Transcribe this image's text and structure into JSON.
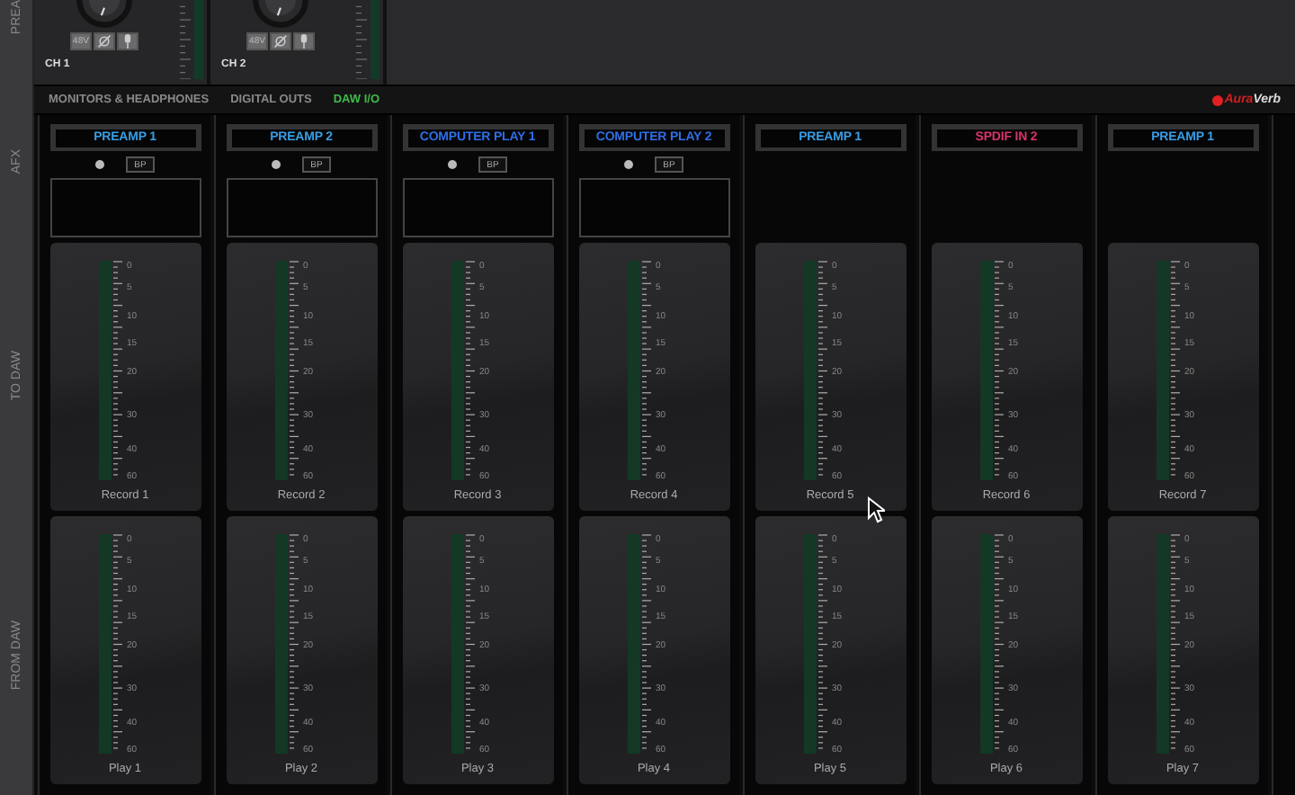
{
  "rail": {
    "preamp": "PREA",
    "afx": "AFX",
    "to_daw": "TO DAW",
    "from_daw": "FROM DAW"
  },
  "strips": [
    {
      "name": "CH 1",
      "phantom": "48V"
    },
    {
      "name": "CH 2",
      "phantom": "48V"
    }
  ],
  "tabs": [
    {
      "label": "MONITORS & HEADPHONES",
      "selected": false
    },
    {
      "label": "DIGITAL OUTS",
      "selected": false
    },
    {
      "label": "DAW I/O",
      "selected": true
    }
  ],
  "logo": {
    "accent": "Aura",
    "rest": "Verb"
  },
  "columns": [
    {
      "source": "PREAMP 1",
      "kind": "preamp",
      "afx": true,
      "bp": "BP",
      "record": "Record 1",
      "record_scale": [
        "0",
        "5",
        "10",
        "15",
        "20",
        "30",
        "40",
        "60"
      ],
      "play": "Play 1",
      "play_scale": [
        "0",
        "5",
        "10",
        "15",
        "20",
        "30",
        "40",
        "60"
      ]
    },
    {
      "source": "PREAMP 2",
      "kind": "preamp",
      "afx": true,
      "bp": "BP",
      "record": "Record 2",
      "record_scale": [
        "0",
        "5",
        "10",
        "15",
        "20",
        "30",
        "40",
        "60"
      ],
      "play": "Play 2",
      "play_scale": [
        "0",
        "5",
        "10",
        "15",
        "20",
        "30",
        "40",
        "60"
      ]
    },
    {
      "source": "COMPUTER PLAY 1",
      "kind": "computer",
      "afx": true,
      "bp": "BP",
      "record": "Record 3",
      "record_scale": [
        "0",
        "5",
        "10",
        "15",
        "20",
        "30",
        "40",
        "60"
      ],
      "play": "Play 3",
      "play_scale": [
        "0",
        "5",
        "10",
        "15",
        "20",
        "30",
        "40",
        "60"
      ]
    },
    {
      "source": "COMPUTER PLAY 2",
      "kind": "computer",
      "afx": true,
      "bp": "BP",
      "record": "Record 4",
      "record_scale": [
        "0",
        "5",
        "10",
        "15",
        "20",
        "30",
        "40",
        "60"
      ],
      "play": "Play 4",
      "play_scale": [
        "0",
        "5",
        "10",
        "15",
        "20",
        "30",
        "40",
        "60"
      ]
    },
    {
      "source": "PREAMP 1",
      "kind": "preamp",
      "afx": false,
      "record": "Record 5",
      "record_scale": [
        "0",
        "5",
        "10",
        "15",
        "20",
        "30",
        "40",
        "60"
      ],
      "play": "Play 5",
      "play_scale": [
        "0",
        "5",
        "10",
        "15",
        "20",
        "30",
        "40",
        "60"
      ]
    },
    {
      "source": "SPDIF IN 2",
      "kind": "spdif",
      "afx": false,
      "record": "Record 6",
      "record_scale": [
        "0",
        "5",
        "10",
        "15",
        "20",
        "30",
        "40",
        "60"
      ],
      "play": "Play 6",
      "play_scale": [
        "0",
        "5",
        "10",
        "15",
        "20",
        "30",
        "40",
        "60"
      ]
    },
    {
      "source": "PREAMP 1",
      "kind": "preamp",
      "afx": false,
      "record": "Record 7",
      "record_scale": [
        "0",
        "5",
        "10",
        "15",
        "20",
        "30",
        "40",
        "60"
      ],
      "play": "Play 7",
      "play_scale": [
        "0",
        "5",
        "10",
        "15",
        "20",
        "30",
        "40",
        "60"
      ]
    }
  ]
}
